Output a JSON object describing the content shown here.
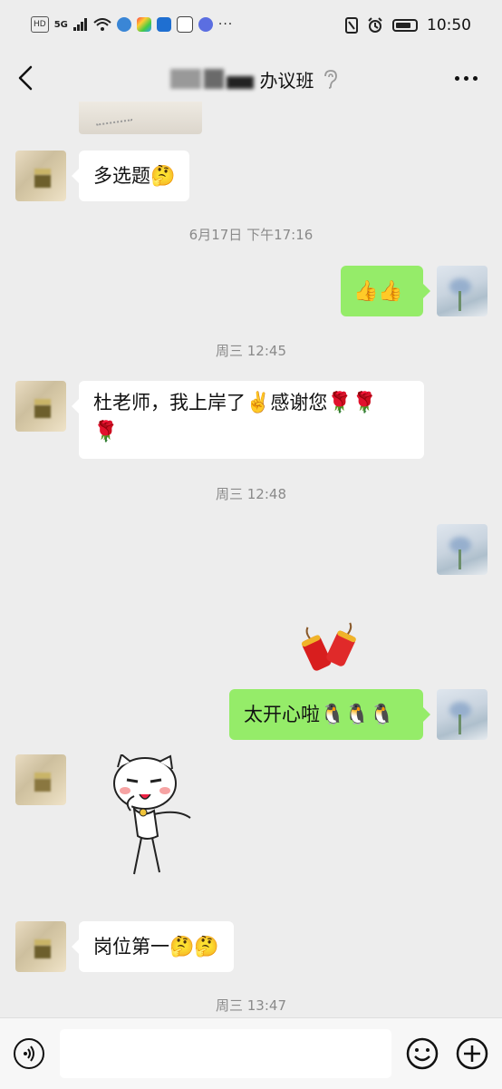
{
  "status_bar": {
    "left_badges": [
      "HD",
      "5G"
    ],
    "time": "10:50"
  },
  "header": {
    "title_visible": "办议班"
  },
  "messages": [
    {
      "type": "text",
      "side": "left",
      "text": "多选题",
      "emoji": [
        "🤔"
      ]
    },
    {
      "type": "timestamp",
      "text": "6月17日 下午17:16"
    },
    {
      "type": "text",
      "side": "right",
      "text": "",
      "emoji": [
        "👍",
        "👍"
      ]
    },
    {
      "type": "timestamp",
      "text": "周三 12:45"
    },
    {
      "type": "text",
      "side": "left",
      "line1": "杜老师，我上岸了",
      "line1_emoji": "✌️",
      "line1_tail": "感谢您",
      "line1_roses": [
        "🌹",
        "🌹"
      ],
      "line2_roses": [
        "🌹"
      ]
    },
    {
      "type": "timestamp",
      "text": "周三 12:48"
    },
    {
      "type": "sticker",
      "side": "right",
      "sticker": "firecracker-sticker"
    },
    {
      "type": "text",
      "side": "right",
      "text": "太开心啦",
      "emoji": [
        "🐧",
        "🐧",
        "🐧"
      ]
    },
    {
      "type": "sticker",
      "side": "left",
      "sticker": "cat-sticker"
    },
    {
      "type": "text",
      "side": "left",
      "text": "岗位第一",
      "emoji": [
        "🤔",
        "🤔"
      ]
    },
    {
      "type": "timestamp",
      "text": "周三 13:47"
    }
  ],
  "input_bar": {
    "placeholder": "",
    "value": ""
  },
  "icons": {
    "back": "back-arrow-icon",
    "more": "more-dots-icon",
    "voice": "voice-icon",
    "emoji": "emoji-icon",
    "plus": "plus-icon"
  },
  "colors": {
    "background": "#ededed",
    "incoming_bubble": "#ffffff",
    "outgoing_bubble": "#95ec69",
    "timestamp": "#8a8a8a"
  }
}
